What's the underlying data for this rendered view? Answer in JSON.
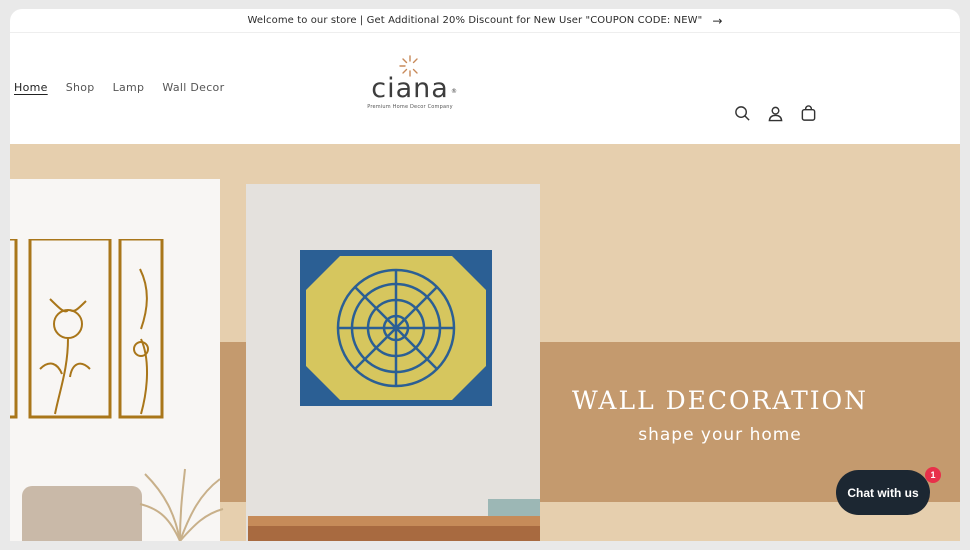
{
  "announcement": {
    "text": "Welcome to our store | Get Additional 20% Discount for New User \"COUPON CODE: NEW\"",
    "arrow": "→"
  },
  "nav": {
    "items": [
      {
        "label": "Home",
        "active": true
      },
      {
        "label": "Shop"
      },
      {
        "label": "Lamp"
      },
      {
        "label": "Wall Decor"
      }
    ]
  },
  "logo": {
    "word": "ciana",
    "registered": "®",
    "tagline": "Premium Home Decor Company"
  },
  "header_icons": [
    "search-icon",
    "account-icon",
    "cart-icon"
  ],
  "hero": {
    "title": "WALL DECORATION",
    "subtitle": "shape your home"
  },
  "chat": {
    "label": "Chat with us",
    "badge": "1"
  },
  "colors": {
    "hero_bg": "#e6cfae",
    "band": "#c49a6e",
    "chat_bg": "#1c2732",
    "badge": "#e8304a",
    "logo_accent": "#c88a5a"
  }
}
